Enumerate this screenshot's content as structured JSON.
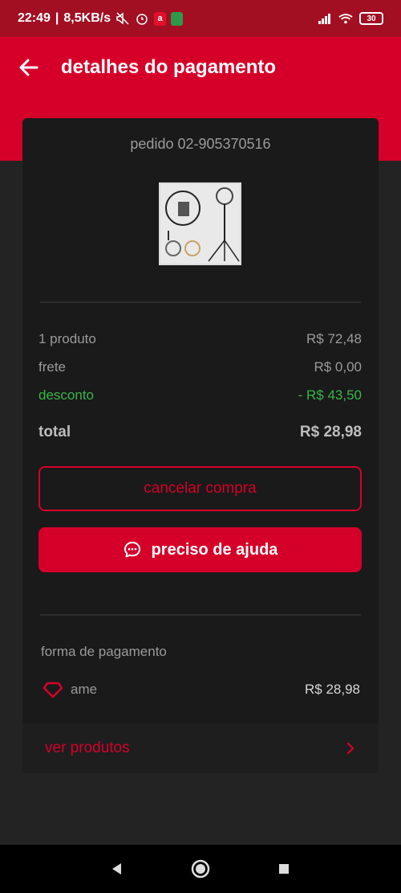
{
  "status_bar": {
    "time": "22:49",
    "network_speed": "8,5KB/s",
    "icons": [
      "mute-icon",
      "alarm-icon",
      "app-badge-icon",
      "shield-icon",
      "signal-icon",
      "wifi-icon"
    ],
    "battery": "30"
  },
  "header": {
    "title": "detalhes do pagamento",
    "back_icon": "arrow-left-icon"
  },
  "order": {
    "label": "pedido 02-905370516"
  },
  "summary": {
    "products_label": "1 produto",
    "products_value": "R$ 72,48",
    "shipping_label": "frete",
    "shipping_value": "R$ 0,00",
    "discount_label": "desconto",
    "discount_value": "- R$ 43,50",
    "total_label": "total",
    "total_value": "R$ 28,98"
  },
  "actions": {
    "cancel_label": "cancelar compra",
    "help_label": "preciso de ajuda",
    "help_icon": "chat-bubble-icon"
  },
  "payment": {
    "title": "forma de pagamento",
    "method": "ame",
    "method_icon": "ame-heart-icon",
    "amount": "R$ 28,98"
  },
  "footer_link": {
    "label": "ver produtos",
    "icon": "chevron-right-icon"
  },
  "colors": {
    "brand_red": "#d50029",
    "status_bar": "#a20f23",
    "discount_green": "#39b54a",
    "background": "#232323",
    "card": "#1a1a1a"
  }
}
